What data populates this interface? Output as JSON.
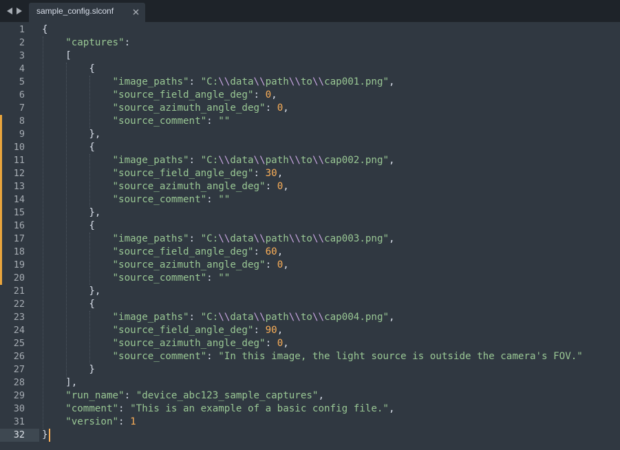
{
  "window": {
    "tab": {
      "filename": "sample_config.slconf",
      "close_glyph": "×",
      "modified": false
    },
    "nav": {
      "back_glyph": "◀",
      "forward_glyph": "▶"
    }
  },
  "editor": {
    "current_line": 32,
    "line_numbers": [
      "1",
      "2",
      "3",
      "4",
      "5",
      "6",
      "7",
      "8",
      "9",
      "10",
      "11",
      "12",
      "13",
      "14",
      "15",
      "16",
      "17",
      "18",
      "19",
      "20",
      "21",
      "22",
      "23",
      "24",
      "25",
      "26",
      "27",
      "28",
      "29",
      "30",
      "31",
      "32"
    ],
    "modified_line_ranges": [
      [
        8,
        20
      ]
    ],
    "lines": [
      [
        {
          "t": "{",
          "c": "punc"
        }
      ],
      [
        {
          "t": "    ",
          "c": "punc"
        },
        {
          "t": "\"captures\"",
          "c": "key"
        },
        {
          "t": ":",
          "c": "punc"
        }
      ],
      [
        {
          "t": "    [",
          "c": "punc"
        }
      ],
      [
        {
          "t": "        {",
          "c": "punc"
        }
      ],
      [
        {
          "t": "            ",
          "c": "punc"
        },
        {
          "t": "\"image_paths\"",
          "c": "key"
        },
        {
          "t": ": ",
          "c": "punc"
        },
        {
          "t": "\"C:",
          "c": "str"
        },
        {
          "t": "\\\\",
          "c": "esc"
        },
        {
          "t": "data",
          "c": "str"
        },
        {
          "t": "\\\\",
          "c": "esc"
        },
        {
          "t": "path",
          "c": "str"
        },
        {
          "t": "\\\\",
          "c": "esc"
        },
        {
          "t": "to",
          "c": "str"
        },
        {
          "t": "\\\\",
          "c": "esc"
        },
        {
          "t": "cap001.png\"",
          "c": "str"
        },
        {
          "t": ",",
          "c": "punc"
        }
      ],
      [
        {
          "t": "            ",
          "c": "punc"
        },
        {
          "t": "\"source_field_angle_deg\"",
          "c": "key"
        },
        {
          "t": ": ",
          "c": "punc"
        },
        {
          "t": "0",
          "c": "num"
        },
        {
          "t": ",",
          "c": "punc"
        }
      ],
      [
        {
          "t": "            ",
          "c": "punc"
        },
        {
          "t": "\"source_azimuth_angle_deg\"",
          "c": "key"
        },
        {
          "t": ": ",
          "c": "punc"
        },
        {
          "t": "0",
          "c": "num"
        },
        {
          "t": ",",
          "c": "punc"
        }
      ],
      [
        {
          "t": "            ",
          "c": "punc"
        },
        {
          "t": "\"source_comment\"",
          "c": "key"
        },
        {
          "t": ": ",
          "c": "punc"
        },
        {
          "t": "\"\"",
          "c": "str"
        }
      ],
      [
        {
          "t": "        },",
          "c": "punc"
        }
      ],
      [
        {
          "t": "        {",
          "c": "punc"
        }
      ],
      [
        {
          "t": "            ",
          "c": "punc"
        },
        {
          "t": "\"image_paths\"",
          "c": "key"
        },
        {
          "t": ": ",
          "c": "punc"
        },
        {
          "t": "\"C:",
          "c": "str"
        },
        {
          "t": "\\\\",
          "c": "esc"
        },
        {
          "t": "data",
          "c": "str"
        },
        {
          "t": "\\\\",
          "c": "esc"
        },
        {
          "t": "path",
          "c": "str"
        },
        {
          "t": "\\\\",
          "c": "esc"
        },
        {
          "t": "to",
          "c": "str"
        },
        {
          "t": "\\\\",
          "c": "esc"
        },
        {
          "t": "cap002.png\"",
          "c": "str"
        },
        {
          "t": ",",
          "c": "punc"
        }
      ],
      [
        {
          "t": "            ",
          "c": "punc"
        },
        {
          "t": "\"source_field_angle_deg\"",
          "c": "key"
        },
        {
          "t": ": ",
          "c": "punc"
        },
        {
          "t": "30",
          "c": "num"
        },
        {
          "t": ",",
          "c": "punc"
        }
      ],
      [
        {
          "t": "            ",
          "c": "punc"
        },
        {
          "t": "\"source_azimuth_angle_deg\"",
          "c": "key"
        },
        {
          "t": ": ",
          "c": "punc"
        },
        {
          "t": "0",
          "c": "num"
        },
        {
          "t": ",",
          "c": "punc"
        }
      ],
      [
        {
          "t": "            ",
          "c": "punc"
        },
        {
          "t": "\"source_comment\"",
          "c": "key"
        },
        {
          "t": ": ",
          "c": "punc"
        },
        {
          "t": "\"\"",
          "c": "str"
        }
      ],
      [
        {
          "t": "        },",
          "c": "punc"
        }
      ],
      [
        {
          "t": "        {",
          "c": "punc"
        }
      ],
      [
        {
          "t": "            ",
          "c": "punc"
        },
        {
          "t": "\"image_paths\"",
          "c": "key"
        },
        {
          "t": ": ",
          "c": "punc"
        },
        {
          "t": "\"C:",
          "c": "str"
        },
        {
          "t": "\\\\",
          "c": "esc"
        },
        {
          "t": "data",
          "c": "str"
        },
        {
          "t": "\\\\",
          "c": "esc"
        },
        {
          "t": "path",
          "c": "str"
        },
        {
          "t": "\\\\",
          "c": "esc"
        },
        {
          "t": "to",
          "c": "str"
        },
        {
          "t": "\\\\",
          "c": "esc"
        },
        {
          "t": "cap003.png\"",
          "c": "str"
        },
        {
          "t": ",",
          "c": "punc"
        }
      ],
      [
        {
          "t": "            ",
          "c": "punc"
        },
        {
          "t": "\"source_field_angle_deg\"",
          "c": "key"
        },
        {
          "t": ": ",
          "c": "punc"
        },
        {
          "t": "60",
          "c": "num"
        },
        {
          "t": ",",
          "c": "punc"
        }
      ],
      [
        {
          "t": "            ",
          "c": "punc"
        },
        {
          "t": "\"source_azimuth_angle_deg\"",
          "c": "key"
        },
        {
          "t": ": ",
          "c": "punc"
        },
        {
          "t": "0",
          "c": "num"
        },
        {
          "t": ",",
          "c": "punc"
        }
      ],
      [
        {
          "t": "            ",
          "c": "punc"
        },
        {
          "t": "\"source_comment\"",
          "c": "key"
        },
        {
          "t": ": ",
          "c": "punc"
        },
        {
          "t": "\"\"",
          "c": "str"
        }
      ],
      [
        {
          "t": "        },",
          "c": "punc"
        }
      ],
      [
        {
          "t": "        {",
          "c": "punc"
        }
      ],
      [
        {
          "t": "            ",
          "c": "punc"
        },
        {
          "t": "\"image_paths\"",
          "c": "key"
        },
        {
          "t": ": ",
          "c": "punc"
        },
        {
          "t": "\"C:",
          "c": "str"
        },
        {
          "t": "\\\\",
          "c": "esc"
        },
        {
          "t": "data",
          "c": "str"
        },
        {
          "t": "\\\\",
          "c": "esc"
        },
        {
          "t": "path",
          "c": "str"
        },
        {
          "t": "\\\\",
          "c": "esc"
        },
        {
          "t": "to",
          "c": "str"
        },
        {
          "t": "\\\\",
          "c": "esc"
        },
        {
          "t": "cap004.png\"",
          "c": "str"
        },
        {
          "t": ",",
          "c": "punc"
        }
      ],
      [
        {
          "t": "            ",
          "c": "punc"
        },
        {
          "t": "\"source_field_angle_deg\"",
          "c": "key"
        },
        {
          "t": ": ",
          "c": "punc"
        },
        {
          "t": "90",
          "c": "num"
        },
        {
          "t": ",",
          "c": "punc"
        }
      ],
      [
        {
          "t": "            ",
          "c": "punc"
        },
        {
          "t": "\"source_azimuth_angle_deg\"",
          "c": "key"
        },
        {
          "t": ": ",
          "c": "punc"
        },
        {
          "t": "0",
          "c": "num"
        },
        {
          "t": ",",
          "c": "punc"
        }
      ],
      [
        {
          "t": "            ",
          "c": "punc"
        },
        {
          "t": "\"source_comment\"",
          "c": "key"
        },
        {
          "t": ": ",
          "c": "punc"
        },
        {
          "t": "\"In this image, the light source is outside the camera's FOV.\"",
          "c": "str"
        }
      ],
      [
        {
          "t": "        }",
          "c": "punc"
        }
      ],
      [
        {
          "t": "    ],",
          "c": "punc"
        }
      ],
      [
        {
          "t": "    ",
          "c": "punc"
        },
        {
          "t": "\"run_name\"",
          "c": "key"
        },
        {
          "t": ": ",
          "c": "punc"
        },
        {
          "t": "\"device_abc123_sample_captures\"",
          "c": "str"
        },
        {
          "t": ",",
          "c": "punc"
        }
      ],
      [
        {
          "t": "    ",
          "c": "punc"
        },
        {
          "t": "\"comment\"",
          "c": "key"
        },
        {
          "t": ": ",
          "c": "punc"
        },
        {
          "t": "\"This is an example of a basic config file.\"",
          "c": "str"
        },
        {
          "t": ",",
          "c": "punc"
        }
      ],
      [
        {
          "t": "    ",
          "c": "punc"
        },
        {
          "t": "\"version\"",
          "c": "key"
        },
        {
          "t": ": ",
          "c": "punc"
        },
        {
          "t": "1",
          "c": "num"
        }
      ],
      [
        {
          "t": "}",
          "c": "punc"
        }
      ]
    ]
  },
  "theme": {
    "background": "#303841",
    "tabbar_background": "#1e2329",
    "modified_marker": "#e9a53d",
    "cursor": "#f9ae58",
    "string": "#99c794",
    "number": "#f9ae58"
  },
  "icons": {
    "back": "triangle-left-icon",
    "forward": "triangle-right-icon",
    "close": "close-icon"
  }
}
